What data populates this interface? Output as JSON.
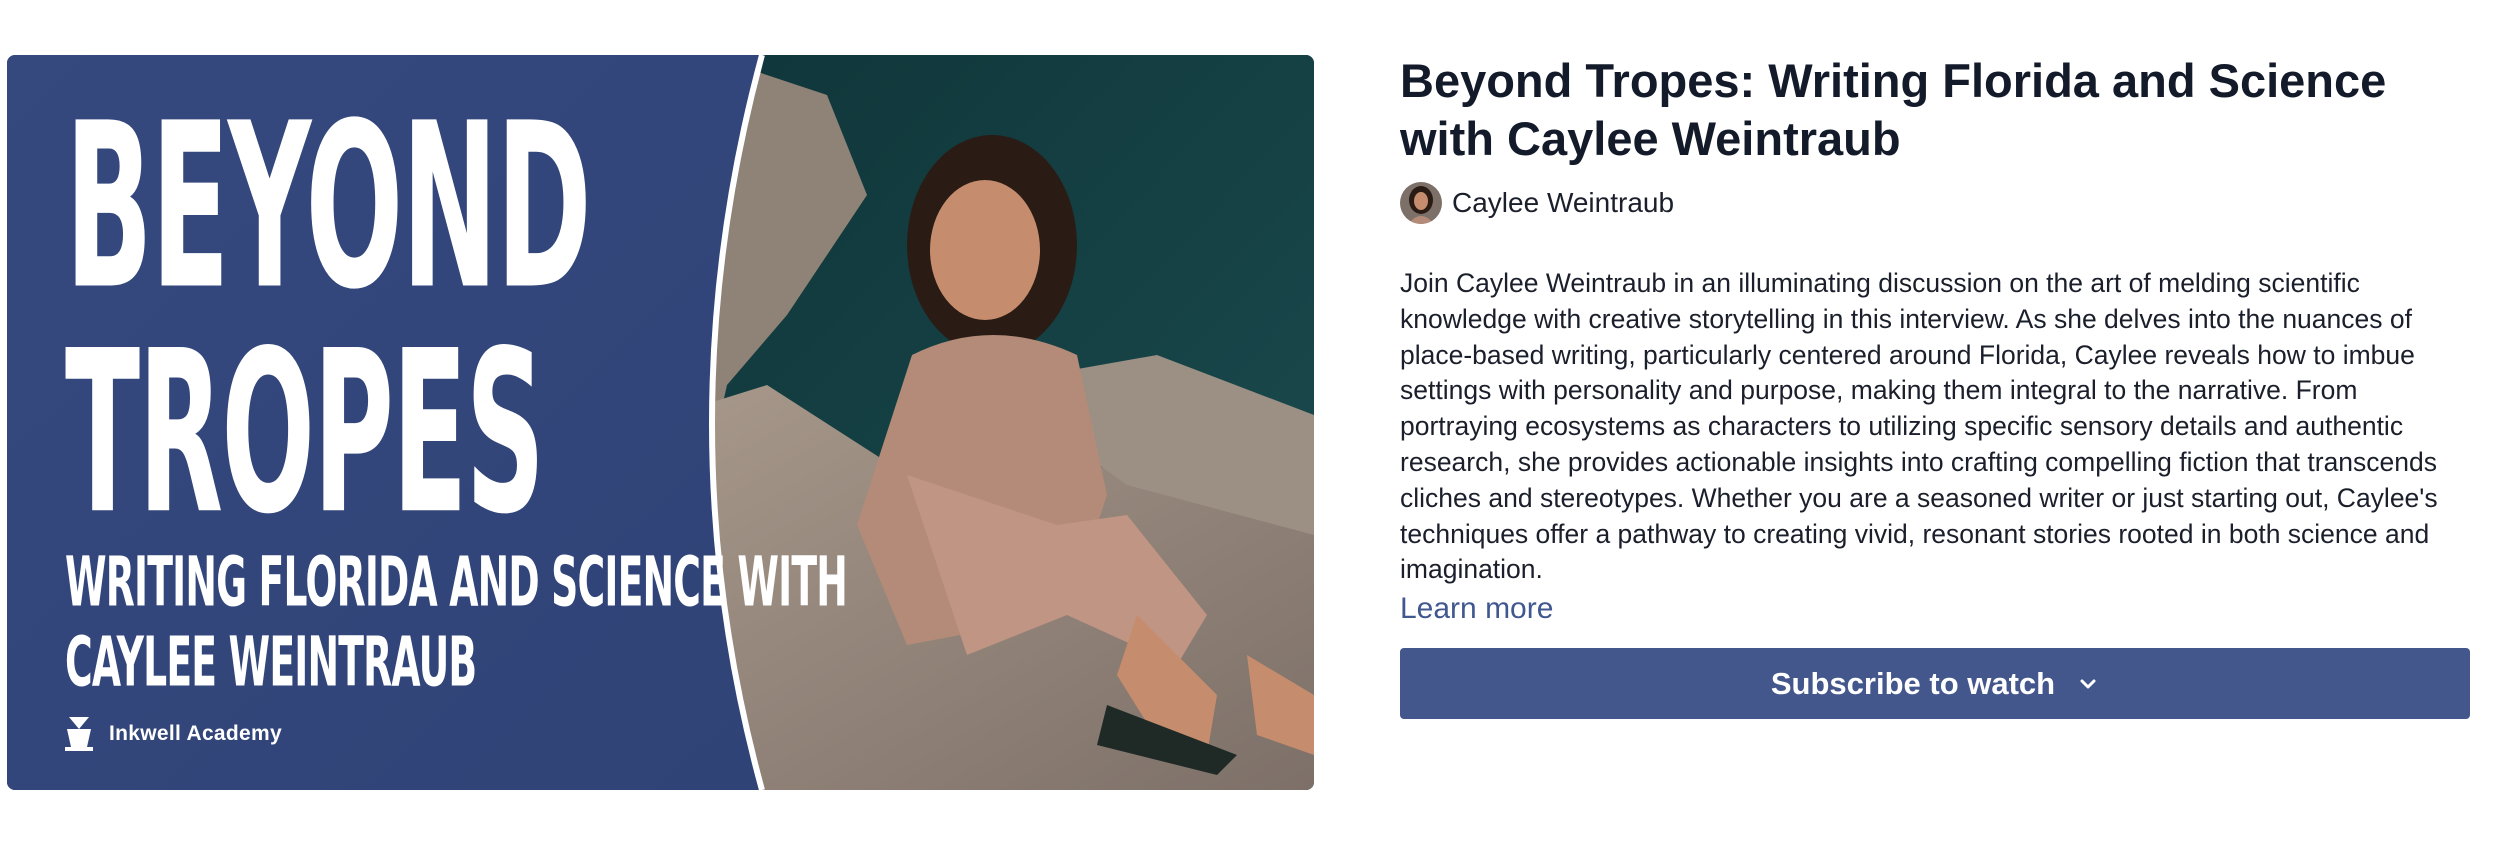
{
  "thumbnail": {
    "title_line1": "BEYOND",
    "title_line2": "TROPES",
    "subtitle_line1": "WRITING FLORIDA AND SCIENCE WITH",
    "subtitle_line2": "CAYLEE WEINTRAUB",
    "brand_name": "Inkwell Academy",
    "colors": {
      "panel": "#34487f",
      "water": "#123a3d",
      "rock": "#9a8c80"
    }
  },
  "video": {
    "title": "Beyond Tropes: Writing Florida and Science with Caylee Weintraub",
    "author": "Caylee Weintraub",
    "description": "Join Caylee Weintraub in an illuminating discussion on the art of melding scientific knowledge with creative storytelling in this interview. As she delves into the nuances of place-based writing, particularly centered around Florida, Caylee reveals how to imbue settings with personality and purpose, making them integral to the narrative. From portraying ecosystems as characters to utilizing specific sensory details and authentic research, she provides actionable insights into crafting compelling fiction that transcends cliches and stereotypes. Whether you are a seasoned writer or just starting out, Caylee's techniques offer a pathway to creating vivid, resonant stories rooted in both science and imagination.",
    "learn_more_label": "Learn more"
  },
  "actions": {
    "subscribe_label": "Subscribe to watch",
    "subscribe_icon": "chevron-down-icon",
    "accent_color": "#43578c",
    "link_color": "#40578f"
  }
}
